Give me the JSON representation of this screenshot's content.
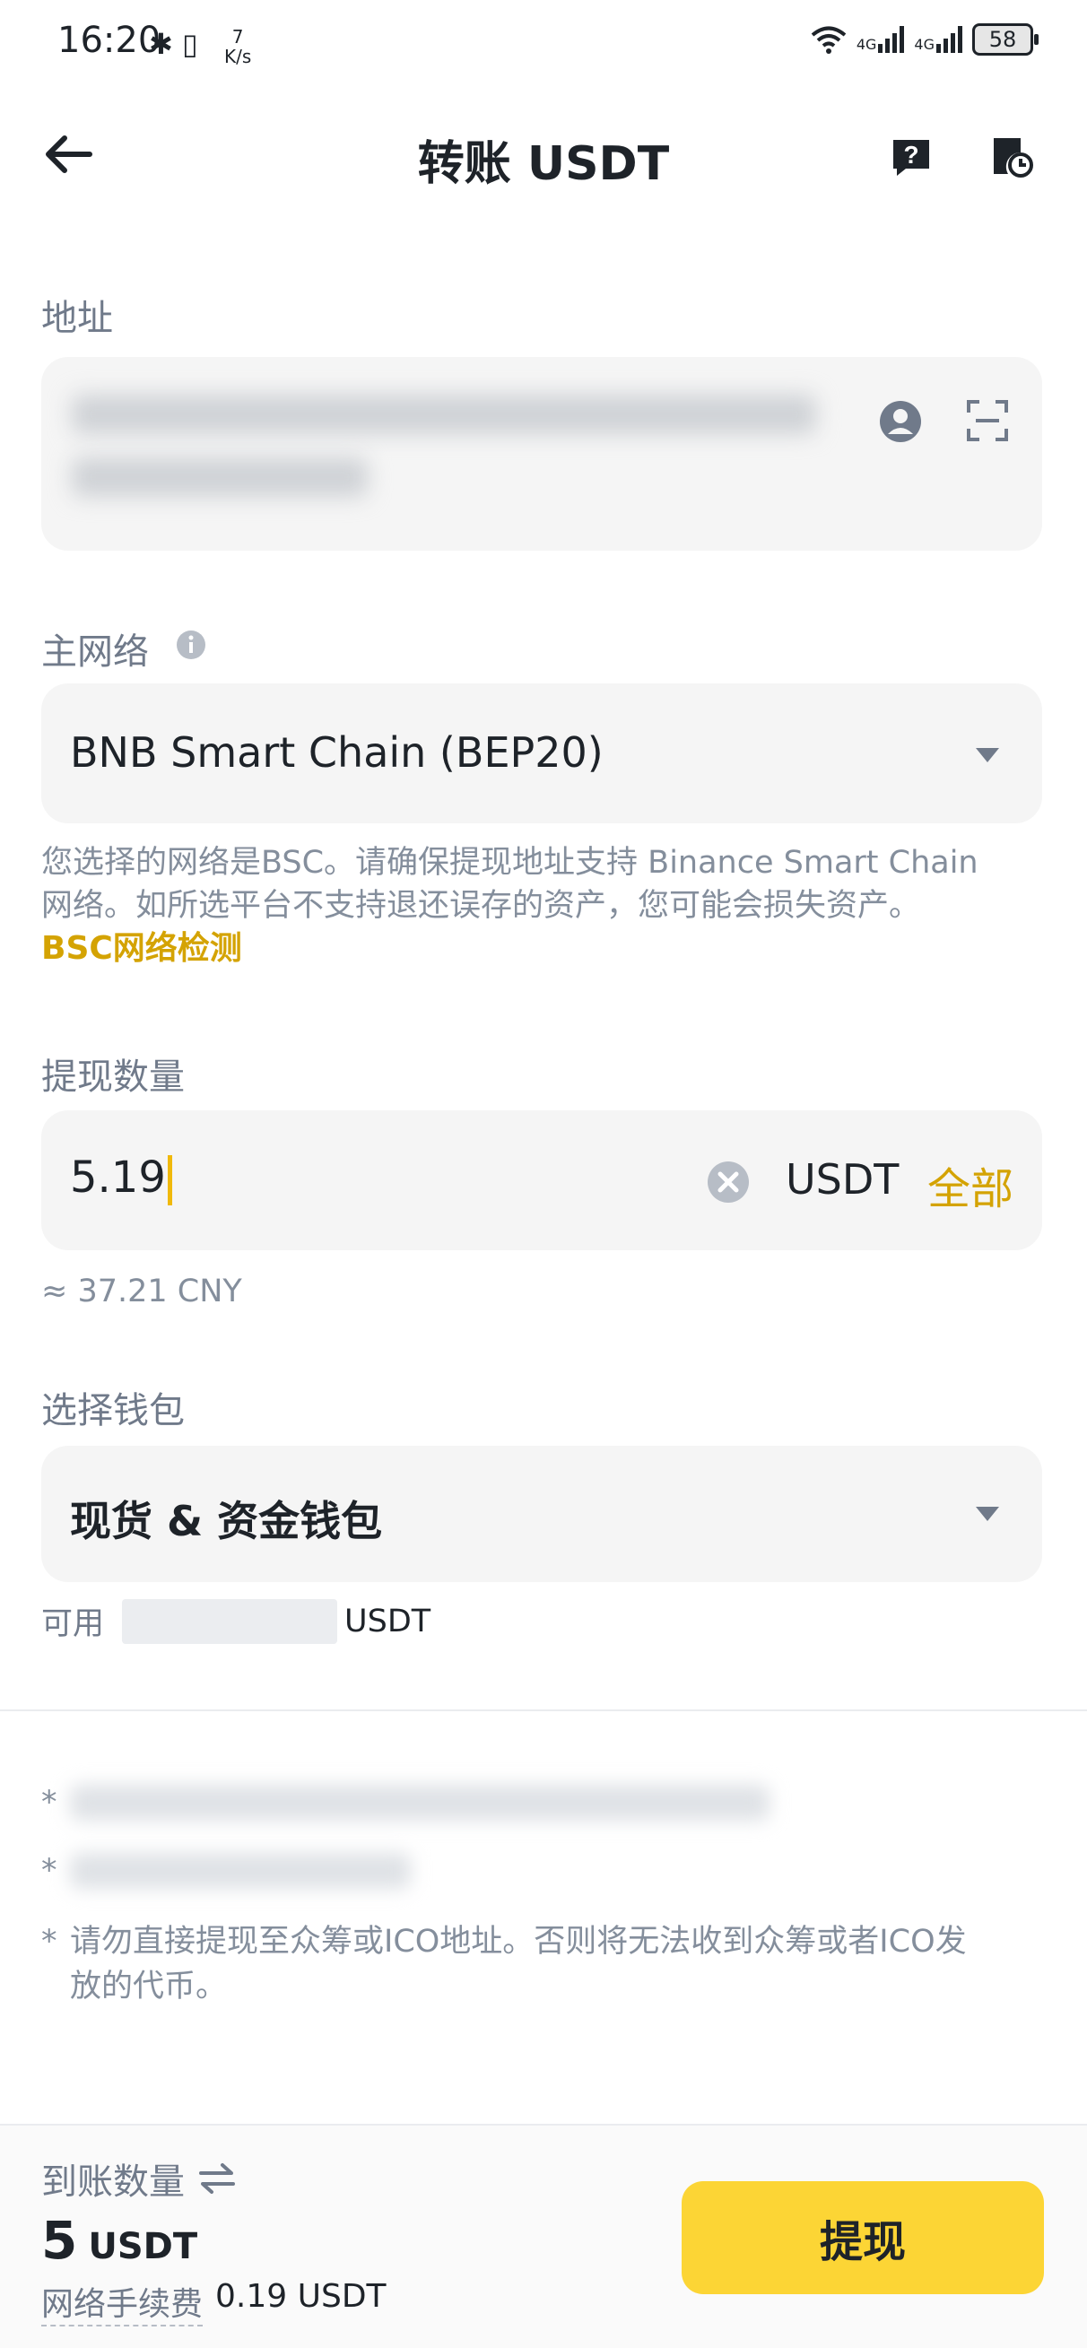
{
  "status_bar": {
    "time": "16:20",
    "net_speed_value": "7",
    "net_speed_unit": "K/s",
    "signal_1": "4G",
    "signal_2": "4G",
    "battery": "58"
  },
  "header": {
    "title": "转账 USDT"
  },
  "address": {
    "label": "地址"
  },
  "network": {
    "label": "主网络",
    "selected": "BNB Smart Chain (BEP20)",
    "notice_line1": "您选择的网络是BSC。请确保提现地址支持 Binance Smart Chain",
    "notice_line2": "网络。如所选平台不支持退还误存的资产，您可能会损失资产。",
    "check_link": "BSC网络检测"
  },
  "amount": {
    "label": "提现数量",
    "value": "5.19",
    "unit": "USDT",
    "max_label": "全部",
    "approx": "≈ 37.21 CNY"
  },
  "wallet": {
    "label": "选择钱包",
    "selected": "现货 & 资金钱包",
    "available_label": "可用",
    "available_unit": "USDT"
  },
  "notes": {
    "bullet": "*",
    "note3_line1": "请勿直接提现至众筹或ICO地址。否则将无法收到众筹或者ICO发",
    "note3_line2": "放的代币。"
  },
  "footer": {
    "receive_label": "到账数量",
    "receive_value": "5",
    "receive_unit": "USDT",
    "fee_label": "网络手续费",
    "fee_value": "0.19 USDT",
    "withdraw_button": "提现"
  },
  "colors": {
    "accent_yellow": "#fcd535",
    "link_gold": "#d4a303",
    "text_primary": "#1e2329",
    "text_secondary": "#707a8a",
    "field_bg": "#f5f5f5"
  },
  "icons": [
    "back-arrow-icon",
    "help-icon",
    "history-icon",
    "contact-icon",
    "scan-icon",
    "info-icon",
    "dropdown-icon",
    "clear-icon",
    "swap-icon"
  ]
}
